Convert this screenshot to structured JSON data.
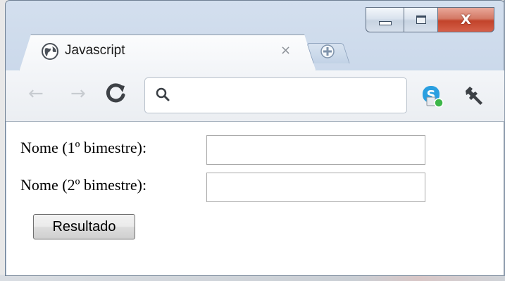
{
  "window": {
    "controls": {
      "minimize_icon": "minimize-icon",
      "maximize_icon": "maximize-icon",
      "close_glyph": "X"
    }
  },
  "tab": {
    "title": "Javascript",
    "close_glyph": "×",
    "favicon_icon": "globe-icon",
    "new_tab_icon": "plus-icon"
  },
  "toolbar": {
    "back_glyph": "←",
    "forward_glyph": "→",
    "reload_icon": "reload-icon",
    "omnibox": {
      "value": "",
      "search_icon": "search-icon"
    },
    "extension_icon": "skype-icon",
    "menu_icon": "wrench-icon"
  },
  "form": {
    "field1_label": "Nome (1º bimestre):",
    "field1_value": "",
    "field2_label": "Nome (2º bimestre):",
    "field2_value": "",
    "submit_label": "Resultado"
  },
  "colors": {
    "frame": "#c5d4e8",
    "close_button": "#c2432a",
    "content_bg": "#ffffff"
  }
}
